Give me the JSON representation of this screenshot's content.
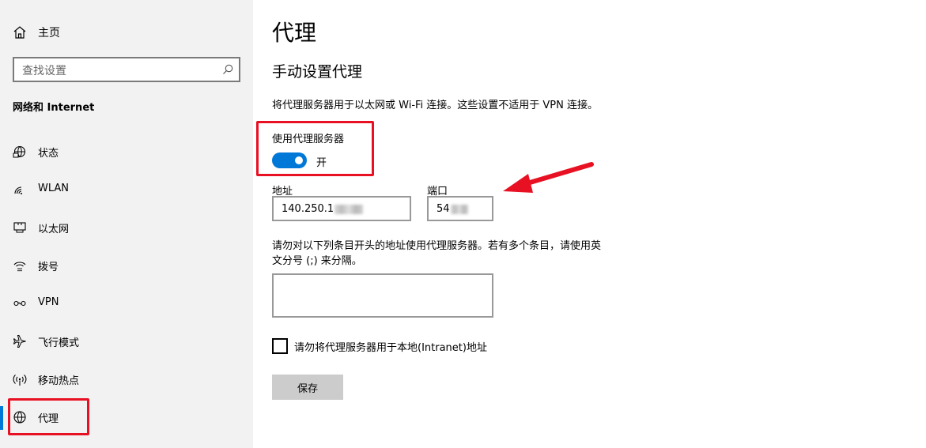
{
  "sidebar": {
    "home": {
      "label": "主页",
      "icon": "home-icon"
    },
    "search": {
      "placeholder": "查找设置",
      "icon": "search-icon"
    },
    "section_title": "网络和 Internet",
    "items": [
      {
        "label": "状态",
        "icon": "globe-status-icon"
      },
      {
        "label": "WLAN",
        "icon": "wifi-icon"
      },
      {
        "label": "以太网",
        "icon": "ethernet-icon"
      },
      {
        "label": "拨号",
        "icon": "dialup-icon"
      },
      {
        "label": "VPN",
        "icon": "vpn-icon"
      },
      {
        "label": "飞行模式",
        "icon": "airplane-icon"
      },
      {
        "label": "移动热点",
        "icon": "hotspot-icon"
      },
      {
        "label": "代理",
        "icon": "globe-icon",
        "active": true
      }
    ]
  },
  "main": {
    "title": "代理",
    "subtitle": "手动设置代理",
    "description": "将代理服务器用于以太网或 Wi-Fi 连接。这些设置不适用于 VPN 连接。",
    "use_proxy": {
      "label": "使用代理服务器",
      "state": "开",
      "on": true
    },
    "address": {
      "label": "地址",
      "value": "140.250.1"
    },
    "port": {
      "label": "端口",
      "value": "54"
    },
    "exceptions": {
      "line1": "请勿对以下列条目开头的地址使用代理服务器。若有多个条目，请使用英",
      "line2": "文分号 (;) 来分隔。",
      "value": ""
    },
    "bypass_local": {
      "label": "请勿将代理服务器用于本地(Intranet)地址",
      "checked": false
    },
    "save_label": "保存"
  },
  "colors": {
    "accent": "#0078d7",
    "highlight": "#e81123",
    "sidebar_bg": "#f2f2f2"
  }
}
